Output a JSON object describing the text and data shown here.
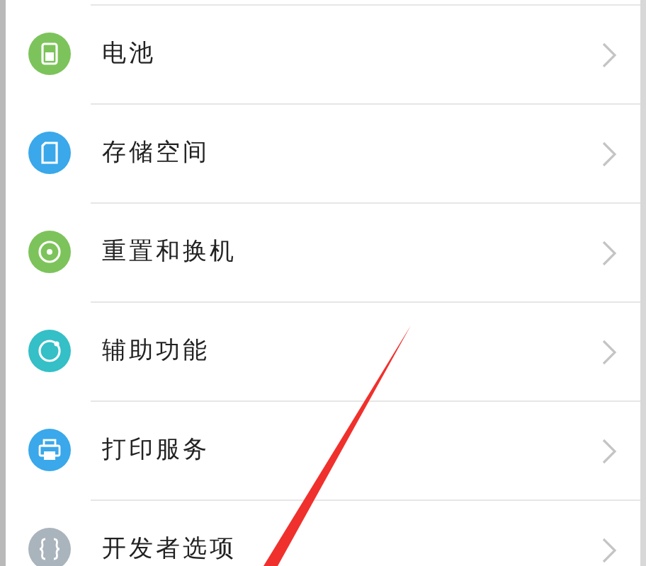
{
  "settings_items": [
    {
      "label": "电池",
      "color": "#7dc35b"
    },
    {
      "label": "存储空间",
      "color": "#3aa8ea"
    },
    {
      "label": "重置和换机",
      "color": "#7dc35b"
    },
    {
      "label": "辅助功能",
      "color": "#35bfc6"
    },
    {
      "label": "打印服务",
      "color": "#3aa8ea"
    },
    {
      "label": "开发者选项",
      "color": "#aab4bc"
    }
  ]
}
